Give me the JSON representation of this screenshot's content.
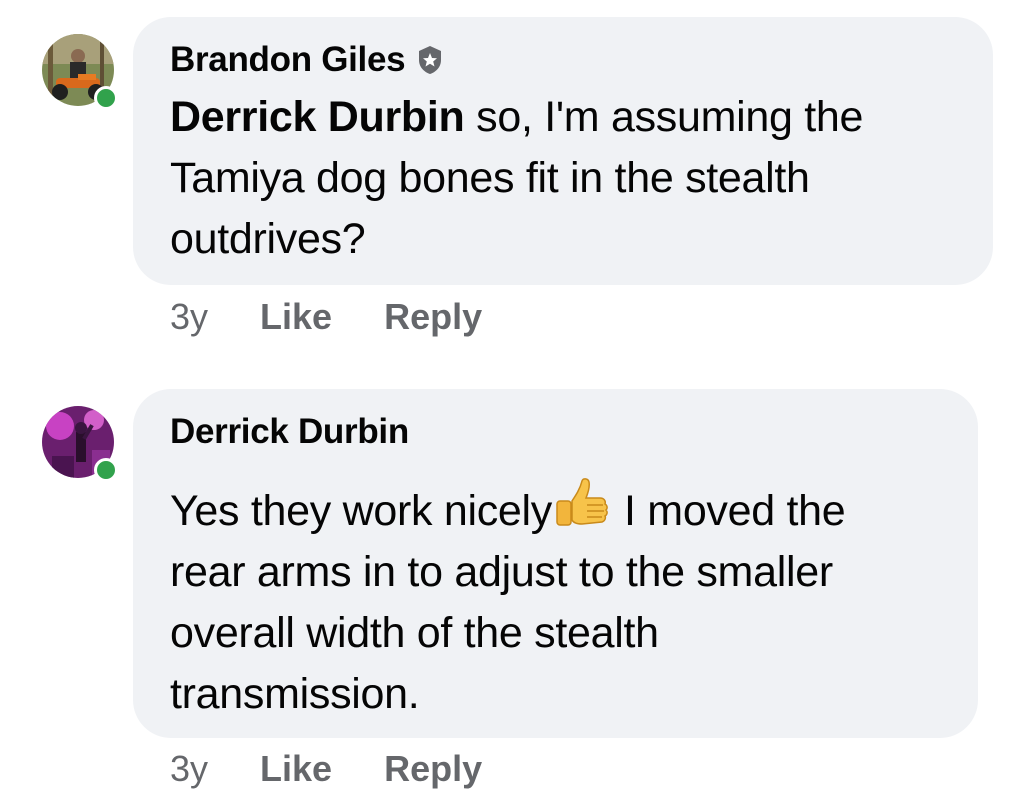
{
  "comments": [
    {
      "author": "Brandon Giles",
      "mention": "Derrick Durbin",
      "text_line1": " so, I'm assuming the",
      "text_line2": "Tamiya dog bones fit in the stealth",
      "text_line3": "outdrives?",
      "time": "3y",
      "like_label": "Like",
      "reply_label": "Reply",
      "badge_icon": "shield-star-icon",
      "online": true
    },
    {
      "author": "Derrick Durbin",
      "text_line1a": "Yes they work nicely",
      "emoji": "thumbs-up-emoji",
      "text_line1b": "I moved the",
      "text_line2": "rear arms in to adjust to the smaller",
      "text_line3": "overall width of the stealth",
      "text_line4": "transmission.",
      "time": "3y",
      "like_label": "Like",
      "reply_label": "Reply",
      "online": true
    }
  ],
  "colors": {
    "bubble_bg": "#f0f2f5",
    "secondary_text": "#65676b",
    "online_green": "#31a24c"
  }
}
